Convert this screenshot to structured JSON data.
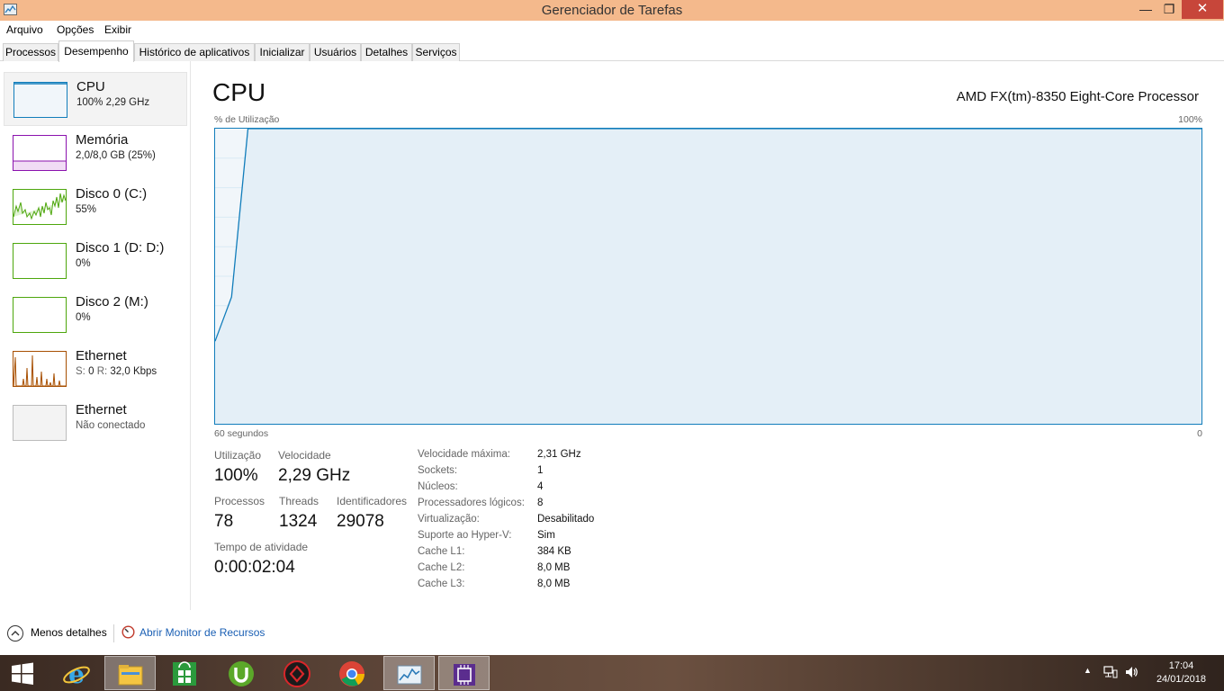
{
  "window": {
    "title": "Gerenciador de Tarefas",
    "minimize_glyph": "—",
    "maximize_glyph": "❐",
    "close_glyph": "✕"
  },
  "menu": [
    "Arquivo",
    "Opções",
    "Exibir"
  ],
  "tabs": [
    "Processos",
    "Desempenho",
    "Histórico de aplicativos",
    "Inicializar",
    "Usuários",
    "Detalhes",
    "Serviços"
  ],
  "active_tab": "Desempenho",
  "devices": [
    {
      "name": "CPU",
      "sub": "100% 2,29 GHz",
      "color": "#117dbb"
    },
    {
      "name": "Memória",
      "sub": "2,0/8,0 GB (25%)",
      "color": "#8b12ae"
    },
    {
      "name": "Disco 0 (C:)",
      "sub": "55%",
      "color": "#4da60c"
    },
    {
      "name": "Disco 1 (D: D:)",
      "sub": "0%",
      "color": "#4da60c"
    },
    {
      "name": "Disco 2 (M:)",
      "sub": "0%",
      "color": "#4da60c"
    },
    {
      "name": "Ethernet",
      "sub_label_s": "S:",
      "sub_value_s": "0",
      "sub_label_r": "R:",
      "sub_value_r": "32,0 Kbps",
      "color": "#a74f01"
    },
    {
      "name": "Ethernet",
      "sub": "Não conectado",
      "color": "#bcbcbc"
    }
  ],
  "main": {
    "title": "CPU",
    "processor": "AMD FX(tm)-8350 Eight-Core Processor",
    "chart_label": "% de Utilização",
    "chart_max": "100%",
    "chart_time": "60 segundos",
    "chart_zero": "0",
    "stats": {
      "utilizacao_label": "Utilização",
      "utilizacao": "100%",
      "velocidade_label": "Velocidade",
      "velocidade": "2,29 GHz",
      "processos_label": "Processos",
      "processos": "78",
      "threads_label": "Threads",
      "threads": "1324",
      "identificadores_label": "Identificadores",
      "identificadores": "29078",
      "tempo_label": "Tempo de atividade",
      "tempo": "0:00:02:04"
    },
    "specs": [
      {
        "label": "Velocidade máxima:",
        "value": "2,31 GHz"
      },
      {
        "label": "Sockets:",
        "value": "1"
      },
      {
        "label": "Núcleos:",
        "value": "4"
      },
      {
        "label": "Processadores lógicos:",
        "value": "8"
      },
      {
        "label": "Virtualização:",
        "value": "Desabilitado"
      },
      {
        "label": "Suporte ao Hyper-V:",
        "value": "Sim"
      },
      {
        "label": "Cache L1:",
        "value": "384 KB"
      },
      {
        "label": "Cache L2:",
        "value": "8,0 MB"
      },
      {
        "label": "Cache L3:",
        "value": "8,0 MB"
      }
    ]
  },
  "chart_data": {
    "type": "line",
    "ylim": [
      0,
      100
    ],
    "xlim": [
      60,
      0
    ],
    "series": [
      {
        "x": [
          60,
          59,
          58,
          57,
          0
        ],
        "y": [
          28,
          43,
          100,
          100,
          100
        ]
      }
    ],
    "grid": true
  },
  "footer": {
    "less_details": "Menos detalhes",
    "resource_monitor": "Abrir Monitor de Recursos"
  },
  "taskbar": {
    "apps": [
      "start-icon",
      "internet-explorer-icon",
      "file-explorer-icon",
      "store-icon",
      "utorrent-icon",
      "game-app-icon",
      "chrome-icon",
      "task-manager-icon",
      "cpu-z-icon"
    ],
    "time": "17:04",
    "date": "24/01/2018"
  }
}
